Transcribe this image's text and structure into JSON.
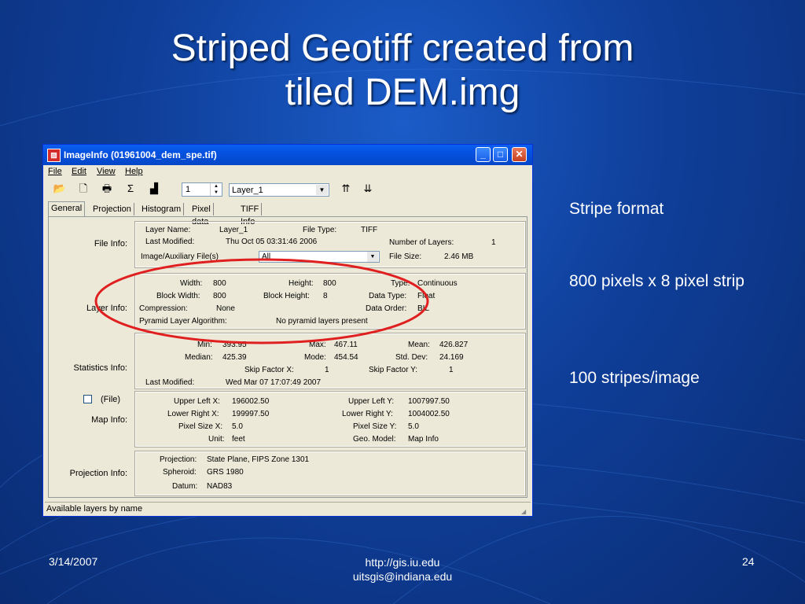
{
  "slide": {
    "title_line1": "Striped Geotiff created from",
    "title_line2": "tiled DEM.img",
    "bullets": [
      "Stripe format",
      "800 pixels x 8 pixel strip",
      "100 stripes/image"
    ],
    "footer": {
      "date": "3/14/2007",
      "url_line1": "http://gis.iu.edu",
      "url_line2": "uitsgis@indiana.edu",
      "page": "24"
    }
  },
  "window": {
    "title": "ImageInfo (01961004_dem_spe.tif)",
    "menu": [
      "File",
      "Edit",
      "View",
      "Help"
    ],
    "toolbar": {
      "layer_number": "1",
      "layer_select": "Layer_1"
    },
    "tabs": [
      "General",
      "Projection",
      "Histogram",
      "Pixel data",
      "TIFF Info"
    ],
    "file_info": {
      "label": "File Info:",
      "layer_name_label": "Layer Name:",
      "layer_name": "Layer_1",
      "file_type_label": "File Type:",
      "file_type": "TIFF",
      "last_modified_label": "Last Modified:",
      "last_modified": "Thu Oct 05 03:31:46 2006",
      "num_layers_label": "Number of Layers:",
      "num_layers": "1",
      "aux_label": "Image/Auxiliary File(s)",
      "aux_value": "All",
      "file_size_label": "File Size:",
      "file_size": "2.46 MB"
    },
    "layer_info": {
      "label": "Layer Info:",
      "width_label": "Width:",
      "width": "800",
      "height_label": "Height:",
      "height": "800",
      "type_label": "Type:",
      "type": "Continuous",
      "block_width_label": "Block Width:",
      "block_width": "800",
      "block_height_label": "Block Height:",
      "block_height": "8",
      "data_type_label": "Data Type:",
      "data_type": "Float",
      "compression_label": "Compression:",
      "compression": "None",
      "data_order_label": "Data Order:",
      "data_order": "BIL",
      "pyramid_label": "Pyramid Layer Algorithm:",
      "pyramid": "No pyramid layers present"
    },
    "statistics_info": {
      "label": "Statistics Info:",
      "min_label": "Min:",
      "min": "393.95",
      "max_label": "Max:",
      "max": "467.11",
      "mean_label": "Mean:",
      "mean": "426.827",
      "median_label": "Median:",
      "median": "425.39",
      "mode_label": "Mode:",
      "mode": "454.54",
      "std_label": "Std. Dev:",
      "std": "24.169",
      "skip_x_label": "Skip Factor X:",
      "skip_x": "1",
      "skip_y_label": "Skip Factor Y:",
      "skip_y": "1",
      "last_modified_label": "Last Modified:",
      "last_modified": "Wed Mar 07 17:07:49 2007"
    },
    "map_info": {
      "label": "Map Info:",
      "file_check_label": "(File)",
      "ul_x_label": "Upper Left X:",
      "ul_x": "196002.50",
      "ul_y_label": "Upper Left Y:",
      "ul_y": "1007997.50",
      "lr_x_label": "Lower Right X:",
      "lr_x": "199997.50",
      "lr_y_label": "Lower Right Y:",
      "lr_y": "1004002.50",
      "px_x_label": "Pixel Size X:",
      "px_x": "5.0",
      "px_y_label": "Pixel Size Y:",
      "px_y": "5.0",
      "unit_label": "Unit:",
      "unit": "feet",
      "geo_label": "Geo. Model:",
      "geo": "Map Info"
    },
    "projection_info": {
      "label": "Projection Info:",
      "projection_label": "Projection:",
      "projection": "State Plane, FIPS Zone 1301",
      "spheroid_label": "Spheroid:",
      "spheroid": "GRS 1980",
      "datum_label": "Datum:",
      "datum": "NAD83"
    },
    "status": "Available layers by name"
  },
  "colors": {
    "annotation": "#e02020",
    "titlebar": "#0551e0"
  }
}
